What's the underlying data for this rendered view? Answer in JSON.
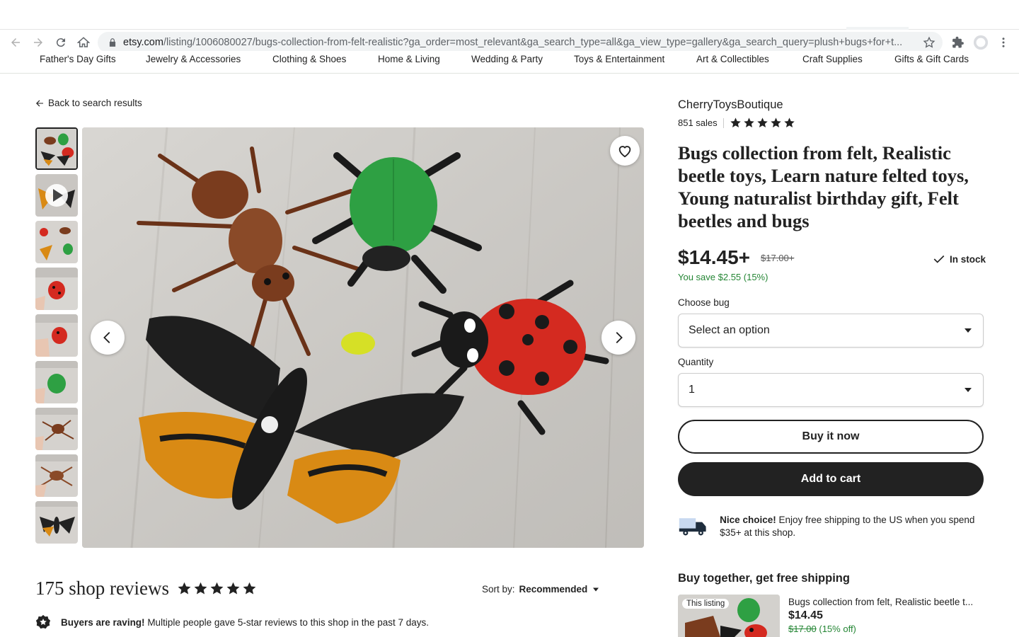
{
  "browser": {
    "url_host": "etsy.com",
    "url_path": "/listing/1006080027/bugs-collection-from-felt-realistic?ga_order=most_relevant&ga_search_type=all&ga_view_type=gallery&ga_search_query=plush+bugs+for+t..."
  },
  "categories": [
    "Father's Day Gifts",
    "Jewelry & Accessories",
    "Clothing & Shoes",
    "Home & Living",
    "Wedding & Party",
    "Toys & Entertainment",
    "Art & Collectibles",
    "Craft Supplies",
    "Gifts & Gift Cards"
  ],
  "back_link": "Back to search results",
  "listing": {
    "shop_name": "CherryToysBoutique",
    "sales": "851 sales",
    "rating": 5,
    "title": "Bugs collection from felt, Realistic beetle toys, Learn nature felted toys, Young naturalist birthday gift, Felt beetles and bugs",
    "price": "$14.45+",
    "original_price": "$17.00+",
    "stock": "In stock",
    "you_save": "You save $2.55 (15%)",
    "variation_label": "Choose bug",
    "variation_value": "Select an option",
    "quantity_label": "Quantity",
    "quantity_value": "1",
    "buy_now": "Buy it now",
    "add_to_cart": "Add to cart",
    "shipping_bold": "Nice choice!",
    "shipping_text": " Enjoy free shipping to the US when you spend $35+ at this shop."
  },
  "buy_together": {
    "heading": "Buy together, get free shipping",
    "badge": "This listing",
    "item_title": "Bugs collection from felt, Realistic beetle t...",
    "item_price": "$14.45",
    "item_orig": "$17.00",
    "item_discount": " (15% off)"
  },
  "reviews": {
    "title": "175 shop reviews",
    "rating": 5,
    "sort_label": "Sort by:",
    "sort_value": "Recommended",
    "raving_bold": "Buyers are raving!",
    "raving_text": " Multiple people gave 5-star reviews to this shop in the past 7 days."
  },
  "colors": {
    "brand_dark": "#222222",
    "savings_green": "#258635",
    "felt_green": "#2ea043",
    "felt_red": "#d42a20",
    "felt_brown": "#7a3c1e",
    "felt_orange": "#d98a14"
  }
}
